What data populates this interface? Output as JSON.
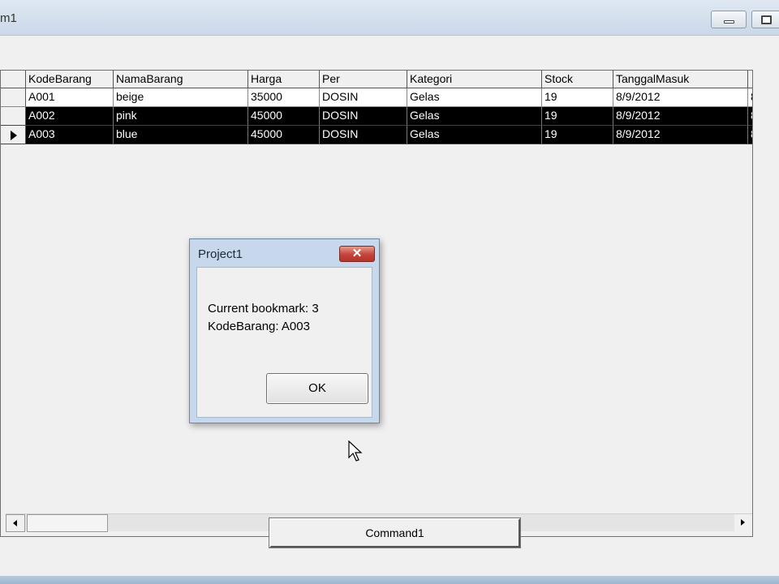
{
  "window": {
    "title": "m1"
  },
  "grid": {
    "columns": [
      "KodeBarang",
      "NamaBarang",
      "Harga",
      "Per",
      "Kategori",
      "Stock",
      "TanggalMasuk",
      ""
    ],
    "rows": [
      {
        "cells": [
          "A001",
          "beige",
          "35000",
          "DOSIN",
          "Gelas",
          "19",
          "8/9/2012",
          "8"
        ],
        "selected": false,
        "current": false
      },
      {
        "cells": [
          "A002",
          "pink",
          "45000",
          "DOSIN",
          "Gelas",
          "19",
          "8/9/2012",
          "8"
        ],
        "selected": true,
        "current": false
      },
      {
        "cells": [
          "A003",
          "blue",
          "45000",
          "DOSIN",
          "Gelas",
          "19",
          "8/9/2012",
          "8"
        ],
        "selected": true,
        "current": true
      }
    ]
  },
  "command_button": {
    "label": "Command1"
  },
  "message_box": {
    "title": "Project1",
    "close_glyph": "✕",
    "line1": "Current bookmark: 3",
    "line2": "KodeBarang: A003",
    "ok_label": "OK"
  }
}
